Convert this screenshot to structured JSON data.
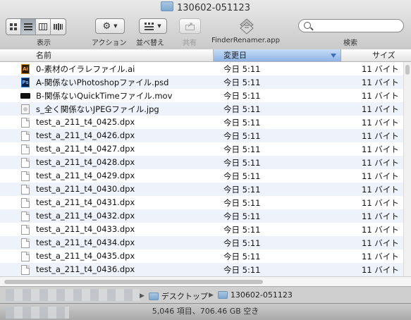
{
  "window": {
    "title": "130602-051123"
  },
  "toolbar": {
    "view_label": "表示",
    "action_label": "アクション",
    "sort_label": "並べ替え",
    "share_label": "共有",
    "app_label": "FinderRenamer.app",
    "search_label": "検索",
    "search_placeholder": ""
  },
  "columns": {
    "name": "名前",
    "date": "変更日",
    "size": "サイズ"
  },
  "files": [
    {
      "name": "0-素材のイラレファイル.ai",
      "date": "今日 5:11",
      "size": "11 バイト",
      "icon": "ai-file-icon"
    },
    {
      "name": "A-関係ないPhotoshopファイル.psd",
      "date": "今日 5:11",
      "size": "11 バイト",
      "icon": "psd-file-icon"
    },
    {
      "name": "B-関係ないQuickTimeファイル.mov",
      "date": "今日 5:11",
      "size": "11 バイト",
      "icon": "mov-file-icon"
    },
    {
      "name": "s_全く関係ないJPEGファイル.jpg",
      "date": "今日 5:11",
      "size": "11 バイト",
      "icon": "jpg-file-icon"
    },
    {
      "name": "test_a_211_t4_0425.dpx",
      "date": "今日 5:11",
      "size": "11 バイト",
      "icon": "document-icon"
    },
    {
      "name": "test_a_211_t4_0426.dpx",
      "date": "今日 5:11",
      "size": "11 バイト",
      "icon": "document-icon"
    },
    {
      "name": "test_a_211_t4_0427.dpx",
      "date": "今日 5:11",
      "size": "11 バイト",
      "icon": "document-icon"
    },
    {
      "name": "test_a_211_t4_0428.dpx",
      "date": "今日 5:11",
      "size": "11 バイト",
      "icon": "document-icon"
    },
    {
      "name": "test_a_211_t4_0429.dpx",
      "date": "今日 5:11",
      "size": "11 バイト",
      "icon": "document-icon"
    },
    {
      "name": "test_a_211_t4_0430.dpx",
      "date": "今日 5:11",
      "size": "11 バイト",
      "icon": "document-icon"
    },
    {
      "name": "test_a_211_t4_0431.dpx",
      "date": "今日 5:11",
      "size": "11 バイト",
      "icon": "document-icon"
    },
    {
      "name": "test_a_211_t4_0432.dpx",
      "date": "今日 5:11",
      "size": "11 バイト",
      "icon": "document-icon"
    },
    {
      "name": "test_a_211_t4_0433.dpx",
      "date": "今日 5:11",
      "size": "11 バイト",
      "icon": "document-icon"
    },
    {
      "name": "test_a_211_t4_0434.dpx",
      "date": "今日 5:11",
      "size": "11 バイト",
      "icon": "document-icon"
    },
    {
      "name": "test_a_211_t4_0435.dpx",
      "date": "今日 5:11",
      "size": "11 バイト",
      "icon": "document-icon"
    },
    {
      "name": "test_a_211_t4_0436.dpx",
      "date": "今日 5:11",
      "size": "11 バイト",
      "icon": "document-icon"
    }
  ],
  "pathbar": {
    "items": [
      "デスクトップ",
      "130602-051123"
    ]
  },
  "status": {
    "text": "5,046 項目、706.46 GB 空き"
  }
}
